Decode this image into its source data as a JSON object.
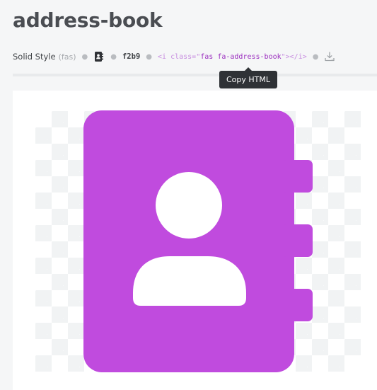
{
  "icon": {
    "name": "address-book",
    "style_label": "Solid Style",
    "prefix": "(fas)",
    "unicode": "f2b9",
    "code_open": "<i class=\"",
    "code_class": "fas fa-address-book",
    "code_close": "\"></i>",
    "color": "#c04bde"
  },
  "tooltip": {
    "text": "Copy HTML"
  }
}
